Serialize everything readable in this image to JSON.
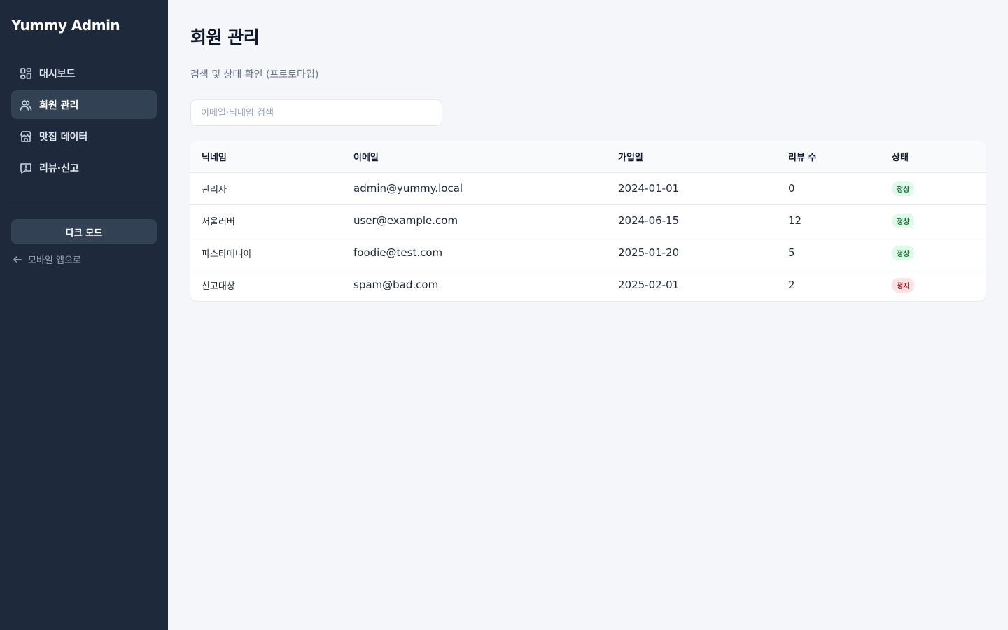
{
  "sidebar": {
    "brand": "Yummy Admin",
    "items": [
      {
        "label": "대시보드",
        "icon": "dashboard-grid-icon"
      },
      {
        "label": "회원 관리",
        "icon": "users-icon"
      },
      {
        "label": "맛집 데이터",
        "icon": "store-icon"
      },
      {
        "label": "리뷰·신고",
        "icon": "message-alert-icon"
      }
    ],
    "active_index": 1,
    "dark_mode_label": "다크 모드",
    "back_label": "모바일 앱으로",
    "back_icon": "arrow-left-icon"
  },
  "main": {
    "title": "회원 관리",
    "subtitle": "검색 및 상태 확인 (프로토타입)",
    "search_placeholder": "이메일·닉네임 검색",
    "table": {
      "columns": [
        "닉네임",
        "이메일",
        "가입일",
        "리뷰 수",
        "상태"
      ],
      "rows": [
        {
          "nickname": "관리자",
          "email": "admin@yummy.local",
          "joined": "2024-01-01",
          "reviews": "0",
          "status": "정상",
          "status_type": "ok"
        },
        {
          "nickname": "서울러버",
          "email": "user@example.com",
          "joined": "2024-06-15",
          "reviews": "12",
          "status": "정상",
          "status_type": "ok"
        },
        {
          "nickname": "파스타매니아",
          "email": "foodie@test.com",
          "joined": "2025-01-20",
          "reviews": "5",
          "status": "정상",
          "status_type": "ok"
        },
        {
          "nickname": "신고대상",
          "email": "spam@bad.com",
          "joined": "2025-02-01",
          "reviews": "2",
          "status": "정지",
          "status_type": "stop"
        }
      ]
    }
  },
  "colors": {
    "sidebar_bg": "#1e293b",
    "active_item_bg": "#334155",
    "page_bg": "#f4f6fa",
    "status_ok_bg": "#dcfce7",
    "status_ok_text": "#166534",
    "status_stop_bg": "#fee2e2",
    "status_stop_text": "#991b1b"
  }
}
